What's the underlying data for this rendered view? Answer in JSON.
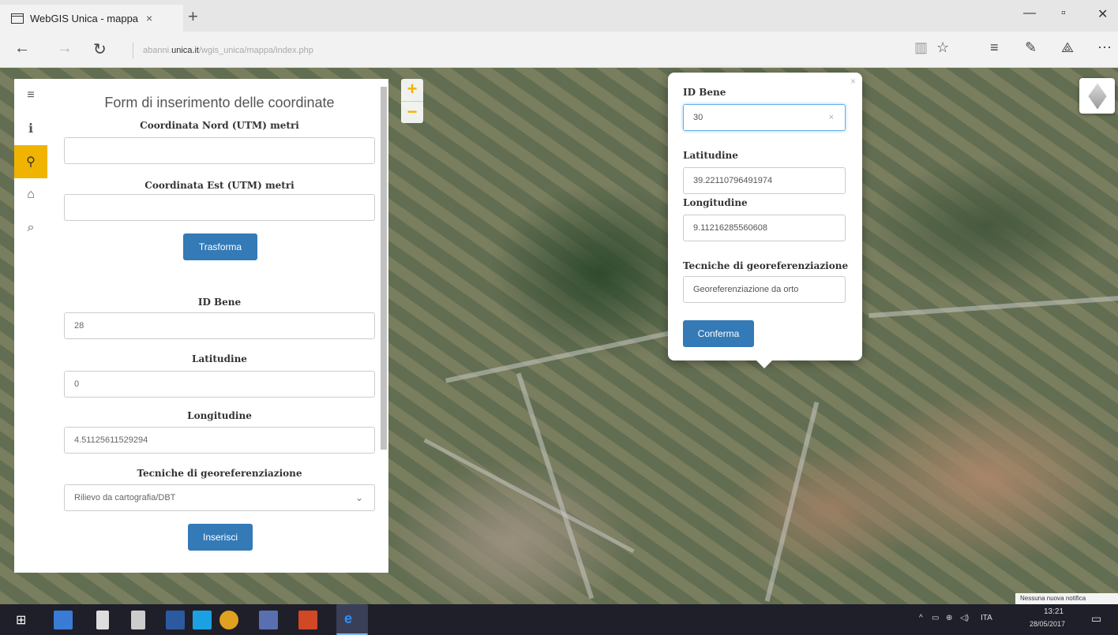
{
  "browser": {
    "tab_title": "WebGIS Unica - mappa",
    "tab_close": "×",
    "new_tab": "+",
    "url_prefix": "abanni.",
    "url_domain": "unica.it",
    "url_path": "/wgis_unica/mappa/index.php"
  },
  "sidebar": {
    "tabs": [
      {
        "icon": "menu-icon",
        "glyph": "≡"
      },
      {
        "icon": "info-icon",
        "glyph": "ℹ"
      },
      {
        "icon": "map-marker-icon",
        "glyph": "⚲"
      },
      {
        "icon": "home-icon",
        "glyph": "⌂"
      },
      {
        "icon": "search-icon",
        "glyph": "⌕"
      }
    ]
  },
  "panel": {
    "title": "Form di inserimento delle coordinate",
    "north_label": "Coordinata Nord (UTM) metri",
    "north_value": "",
    "east_label": "Coordinata Est (UTM) metri",
    "east_value": "",
    "transform_button": "Trasforma",
    "id_label": "ID Bene",
    "id_value": "28",
    "lat_label": "Latitudine",
    "lat_value": "0",
    "lon_label": "Longitudine",
    "lon_value": "4.51125611529294",
    "tech_label": "Tecniche di georeferenziazione",
    "tech_value": "Rilievo da cartografia/DBT",
    "insert_button": "Inserisci"
  },
  "popup": {
    "close": "×",
    "id_label": "ID Bene",
    "id_value": "30",
    "clear": "×",
    "lat_label": "Latitudine",
    "lat_value": "39.22110796491974",
    "lon_label": "Longitudine",
    "lon_value": "9.11216285560608",
    "tech_label": "Tecniche di georeferenziazione",
    "tech_value": "Georeferenziazione da orto",
    "confirm_button": "Conferma"
  },
  "map": {
    "zoom_in": "+",
    "zoom_out": "−",
    "attribution": "Nessuna nuova notifica"
  },
  "taskbar": {
    "language": "ITA",
    "time": "13:21",
    "date": "28/05/2017"
  },
  "colors": {
    "accent": "#f0b400",
    "primary_button": "#337ab7"
  }
}
